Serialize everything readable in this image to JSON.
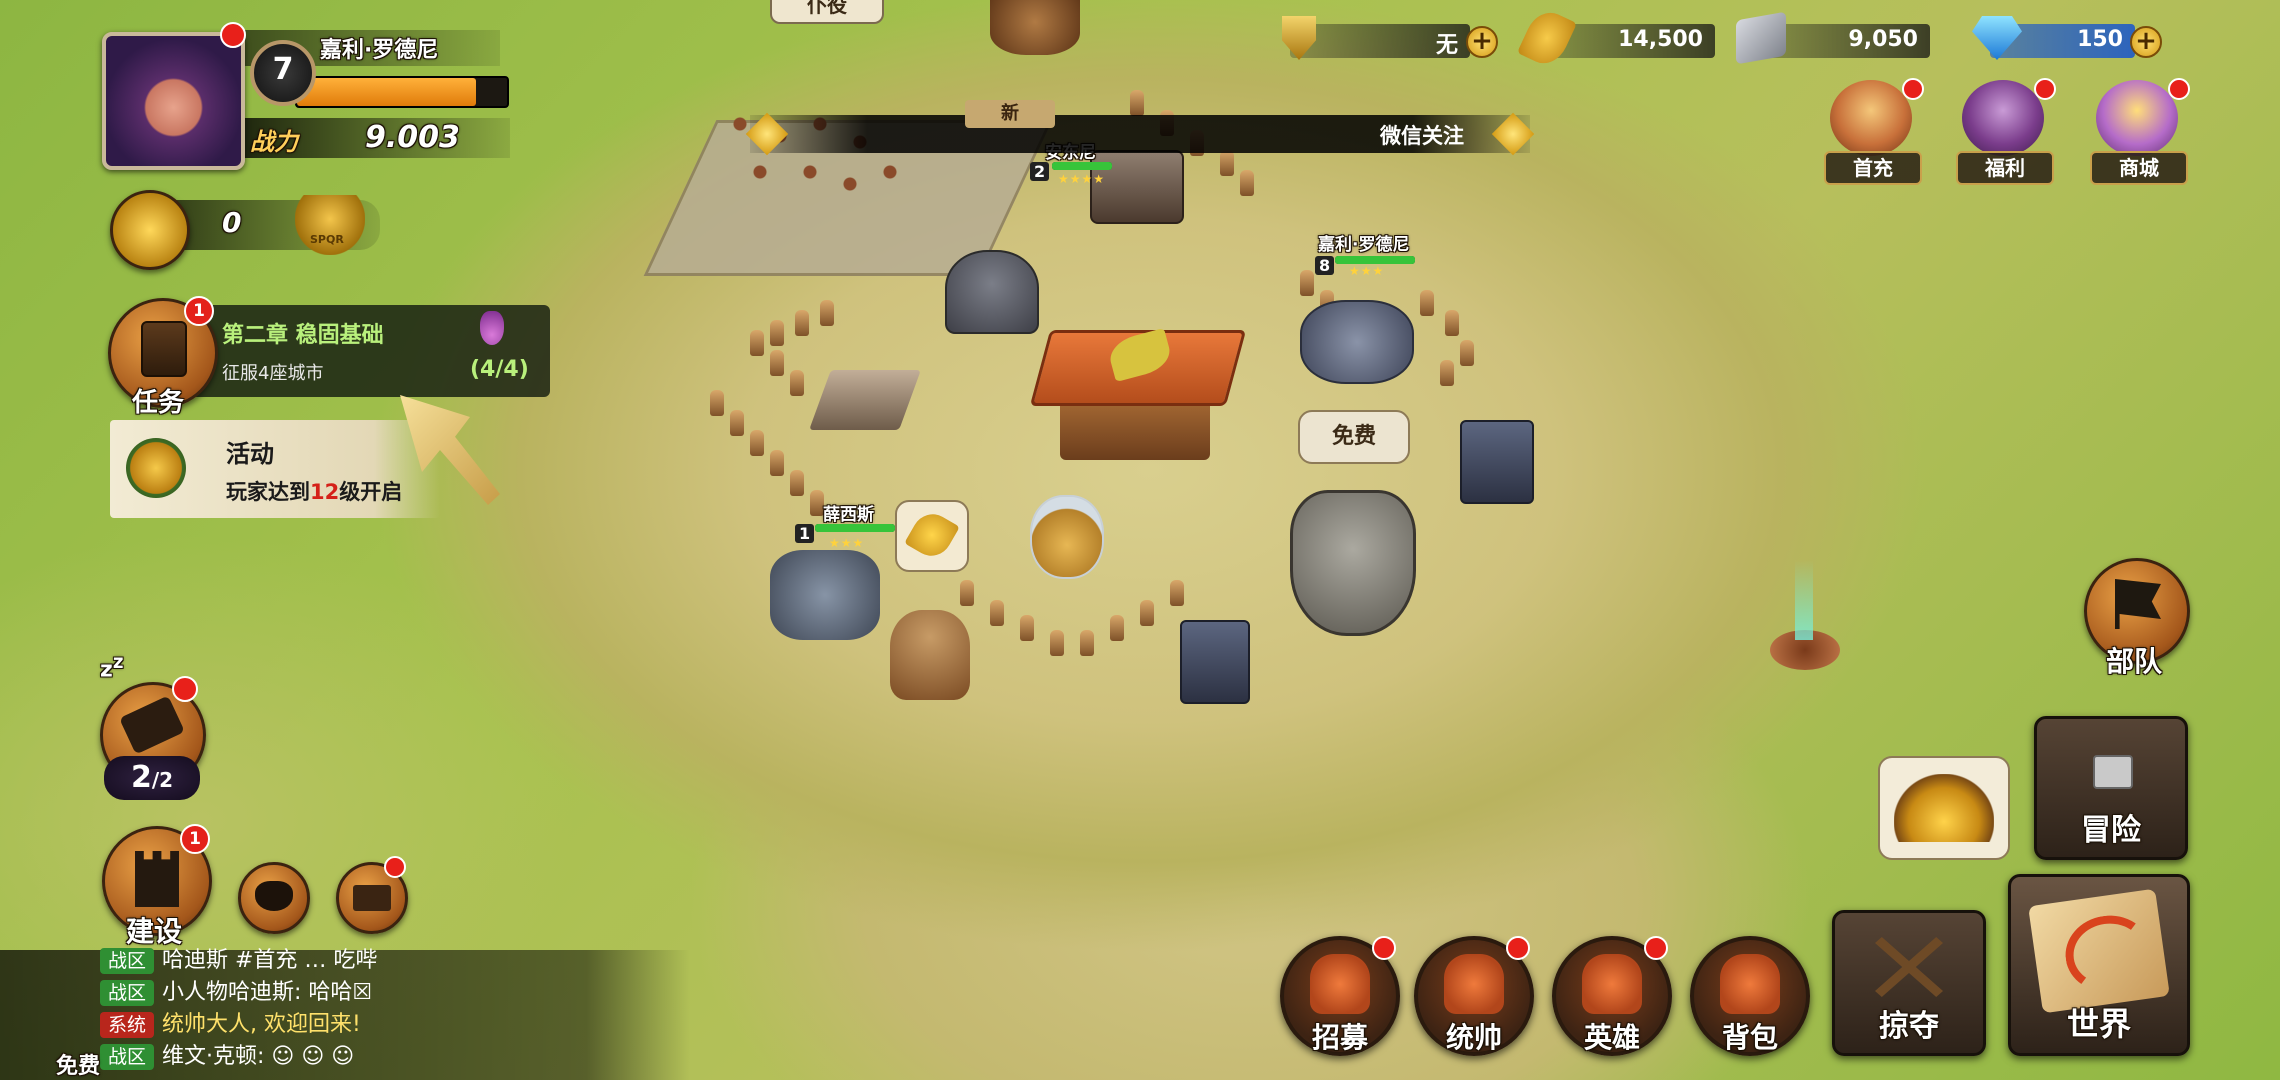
{
  "player": {
    "name": "嘉利·罗德尼",
    "level": "7",
    "power_label": "战力",
    "power_value": "9.003",
    "xp_fraction": 0.85,
    "honor_value": "0"
  },
  "resources": {
    "gold_shield": "无",
    "food": "14,500",
    "stone": "9,050",
    "diamond": "150"
  },
  "announcement": {
    "left_text": "新",
    "right_text": "微信关注"
  },
  "top_right": [
    {
      "label": "首充",
      "icon": "king-portrait-icon"
    },
    {
      "label": "福利",
      "icon": "treasure-chest-icon"
    },
    {
      "label": "商城",
      "icon": "gift-box-icon"
    }
  ],
  "quest": {
    "button_label": "任务",
    "badge": "1",
    "title": "第二章 稳固基础",
    "desc": "征服4座城市",
    "progress": "(4/4)"
  },
  "event": {
    "title": "活动",
    "desc_prefix": "玩家达到",
    "desc_level": "12",
    "desc_suffix": "级开启"
  },
  "left_buttons": {
    "builder_count": "2",
    "builder_total": "2",
    "build_label": "建设",
    "build_badge": "1"
  },
  "map": {
    "top_bubble": "仆役",
    "unit_1_name": "安东尼",
    "unit_1_level": "2",
    "unit_2_name": "嘉利·罗德尼",
    "unit_2_level": "8",
    "unit_3_name": "薛西斯",
    "unit_3_level": "1",
    "free_bubble": "免费"
  },
  "right_buttons": {
    "troops": "部队",
    "adventure": "冒险",
    "plunder": "掠夺",
    "world": "世界"
  },
  "bottom_buttons": [
    {
      "label": "招募",
      "icon": "recruit-mask-icon"
    },
    {
      "label": "统帅",
      "icon": "commander-helmet-icon"
    },
    {
      "label": "英雄",
      "icon": "hero-helmet-icon"
    },
    {
      "label": "背包",
      "icon": "backpack-icon"
    }
  ],
  "chat": [
    {
      "tag": "战区",
      "tag_color": "#2f8f33",
      "text": "哈迪斯 #首充 … 吃哔",
      "color": "#ffffff"
    },
    {
      "tag": "战区",
      "tag_color": "#2f8f33",
      "text": "小人物哈迪斯: 哈哈☒",
      "color": "#ffffff"
    },
    {
      "tag": "系统",
      "tag_color": "#b8261c",
      "text": "统帅大人, 欢迎回来!",
      "color": "#ffe16b"
    },
    {
      "tag": "战区",
      "tag_color": "#2f8f33",
      "text": "维文·克顿: ☺ ☺ ☺",
      "color": "#ffffff"
    }
  ],
  "chat_left_label": "免费"
}
